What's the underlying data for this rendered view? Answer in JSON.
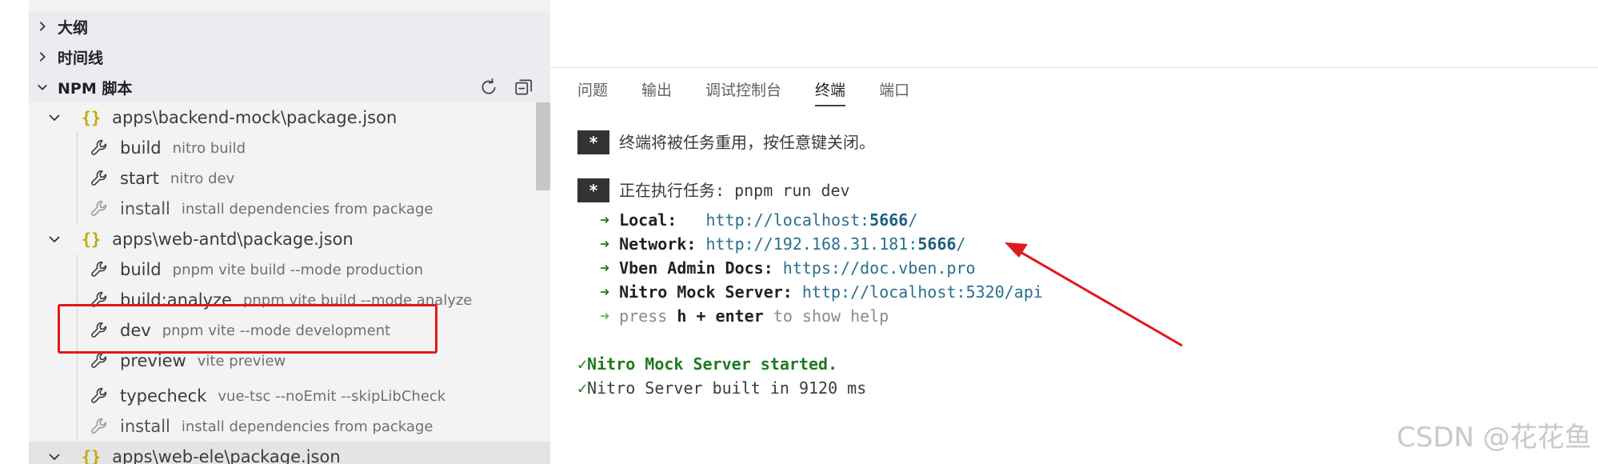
{
  "sidebar": {
    "collapsed_sections": [
      {
        "label": "大纲"
      },
      {
        "label": "时间线"
      }
    ],
    "npm_section": {
      "label": "NPM 脚本"
    },
    "packages": [
      {
        "label": "apps\\backend-mock\\package.json",
        "scripts": [
          {
            "name": "build",
            "cmd": "nitro build"
          },
          {
            "name": "start",
            "cmd": "nitro dev"
          },
          {
            "name": "install",
            "cmd": "install dependencies from package"
          }
        ]
      },
      {
        "label": "apps\\web-antd\\package.json",
        "scripts": [
          {
            "name": "build",
            "cmd": "pnpm vite build --mode production"
          },
          {
            "name": "build:analyze",
            "cmd": "pnpm vite build --mode analyze"
          },
          {
            "name": "dev",
            "cmd": "pnpm vite --mode development"
          },
          {
            "name": "preview",
            "cmd": "vite preview"
          },
          {
            "name": "typecheck",
            "cmd": "vue-tsc --noEmit --skipLibCheck"
          },
          {
            "name": "install",
            "cmd": "install dependencies from package"
          }
        ]
      },
      {
        "label": "apps\\web-ele\\package.json"
      }
    ]
  },
  "panel": {
    "tabs": [
      "问题",
      "输出",
      "调试控制台",
      "终端",
      "端口"
    ],
    "active_tab": "终端"
  },
  "terminal": {
    "star": "*",
    "reuse_msg": "终端将被任务重用，按任意键关闭。",
    "exec_msg": "正在执行任务: pnpm run dev",
    "arrow": "➜",
    "local_label": "Local:",
    "local_url_pre": "http://localhost:",
    "local_port": "5666",
    "local_url_post": "/",
    "network_label": "Network:",
    "network_url_pre": "http://192.168.31.181:",
    "network_port": "5666",
    "network_url_post": "/",
    "docs_label": "Vben Admin Docs:",
    "docs_url": "https://doc.vben.pro",
    "mock_label": "Nitro Mock Server:",
    "mock_url": "http://localhost:5320/api",
    "press": "press",
    "press_key": "h + enter",
    "press_rest": "to show help",
    "check": "✓",
    "mock_started": "Nitro Mock Server started.",
    "built": "Nitro Server built in 9120 ms"
  },
  "watermark": "CSDN @花花鱼"
}
